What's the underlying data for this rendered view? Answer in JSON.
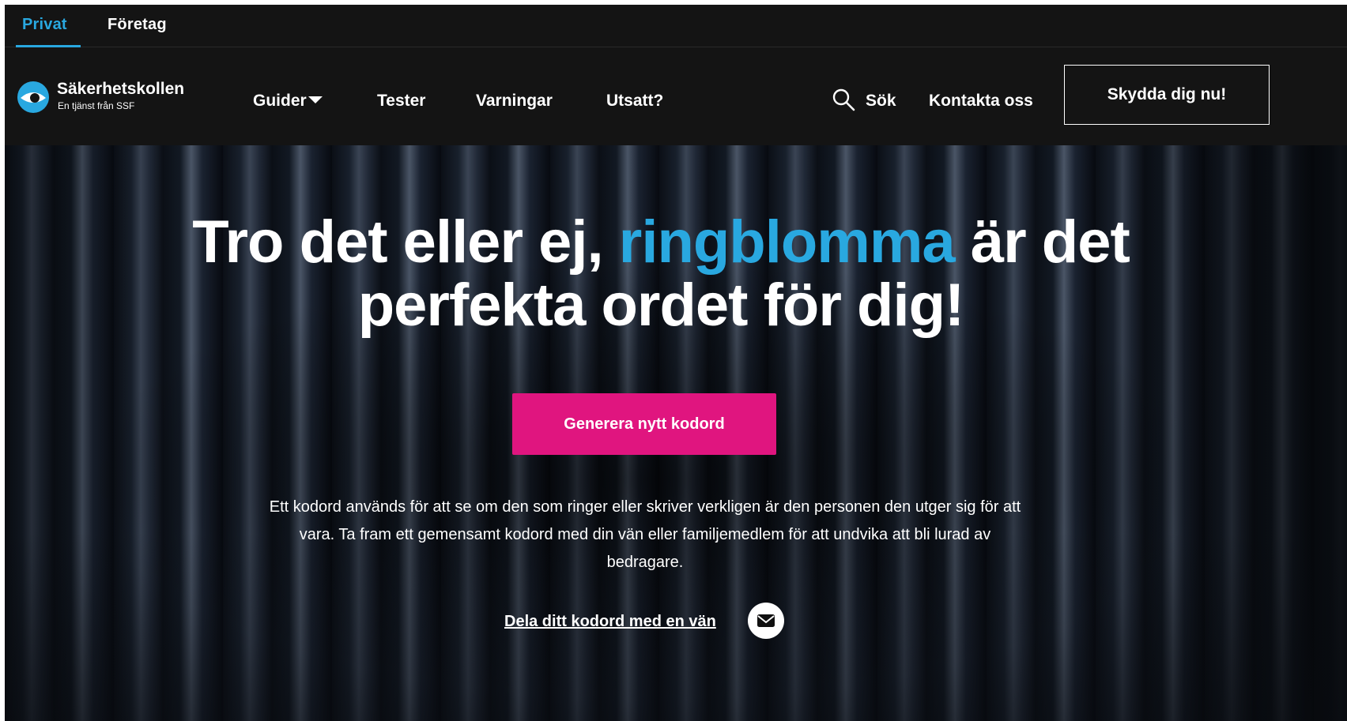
{
  "topbar": {
    "tabs": [
      {
        "label": "Privat",
        "active": true
      },
      {
        "label": "Företag",
        "active": false
      }
    ]
  },
  "logo": {
    "name": "Säkerhetskollen",
    "tagline": "En tjänst från SSF",
    "icon": "eye-logo-icon"
  },
  "nav": {
    "items": [
      {
        "label": "Guider",
        "has_dropdown": true
      },
      {
        "label": "Tester"
      },
      {
        "label": "Varningar"
      },
      {
        "label": "Utsatt?"
      }
    ],
    "search_label": "Sök",
    "contact_label": "Kontakta oss",
    "cta_label": "Skydda dig nu!"
  },
  "hero": {
    "headline_before": "Tro det eller ej,",
    "headline_accent": "ringblomma",
    "headline_after": "är det perfekta ordet för dig!",
    "generate_button": "Generera nytt kodord",
    "description": "Ett kodord används för att se om den som ringer eller skriver verkligen är den personen den utger sig för att vara. Ta fram ett gemensamt kodord med din vän eller familjemedlem för att undvika att bli lurad av bedragare.",
    "share_link": "Dela ditt kodord med en vän",
    "share_icon": "mail-icon"
  },
  "colors": {
    "accent_blue": "#29a8e0",
    "button_pink": "#e0157f",
    "background": "#141414"
  }
}
